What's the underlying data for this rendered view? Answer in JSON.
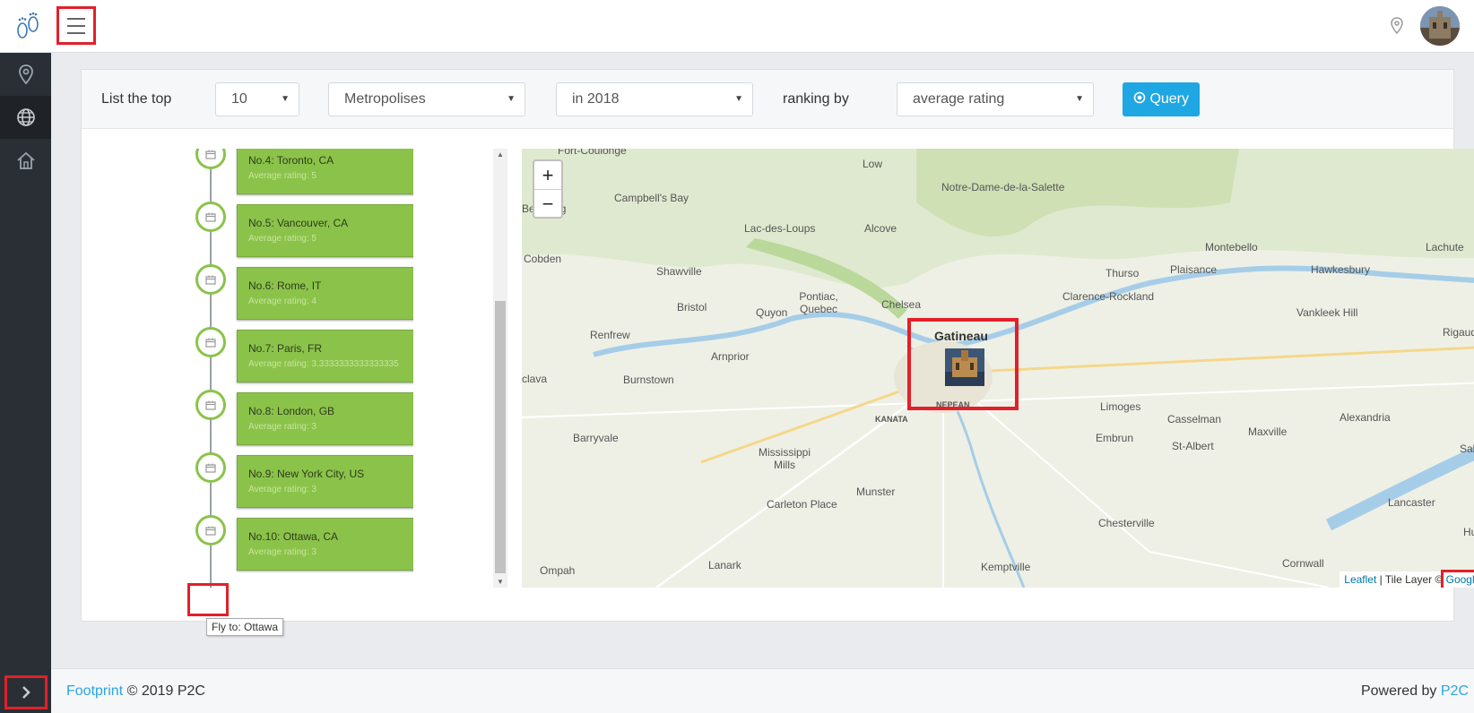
{
  "header": {
    "logo_icon": "footprint-logo-icon",
    "menu_icon": "hamburger-icon",
    "location_icon": "map-pin-icon",
    "avatar_icon": "user-avatar"
  },
  "sidebar": {
    "items": [
      {
        "icon": "map-pin-icon"
      },
      {
        "icon": "globe-icon"
      },
      {
        "icon": "home-icon"
      }
    ],
    "toggle_icon": "chevron-right-icon"
  },
  "toolbar": {
    "list_label": "List the top",
    "count": "10",
    "category": "Metropolises",
    "year": "in 2018",
    "ranking_label": "ranking by",
    "ranking": "average rating",
    "query_label": "Query"
  },
  "timeline": {
    "items": [
      {
        "title": "No.4: Toronto, CA",
        "sub": "Average rating: 5"
      },
      {
        "title": "No.5: Vancouver, CA",
        "sub": "Average rating: 5"
      },
      {
        "title": "No.6: Rome, IT",
        "sub": "Average rating: 4"
      },
      {
        "title": "No.7: Paris, FR",
        "sub": "Average rating: 3.3333333333333335"
      },
      {
        "title": "No.8: London, GB",
        "sub": "Average rating: 3"
      },
      {
        "title": "No.9: New York City, US",
        "sub": "Average rating: 3"
      },
      {
        "title": "No.10: Ottawa, CA",
        "sub": "Average rating: 3"
      }
    ],
    "tooltip": "Fly to: Ottawa"
  },
  "map": {
    "zoom_in": "+",
    "zoom_out": "−",
    "attribution_link": "Leaflet",
    "attribution_text": " | Tile Layer © ",
    "attribution_maps": "Google Maps",
    "labels": {
      "fort_coulonge": "Fort-Coulonge",
      "low": "Low",
      "notre_dame": "Notre-Dame-de-la-Salette",
      "campbells_bay": "Campbell's Bay",
      "lac_des_loups": "Lac-des-Loups",
      "alcove": "Alcove",
      "bergsborg": "Bergburg",
      "cobden": "Cobden",
      "shawville": "Shawville",
      "montebello": "Montebello",
      "lachute": "Lachute",
      "thurso": "Thurso",
      "plaisance": "Plaisance",
      "hawkesbury": "Hawkesbury",
      "bristol": "Bristol",
      "pontiac": "Pontiac, Quebec",
      "quyon": "Quyon",
      "chelsea": "Chelsea",
      "clarence_rockland": "Clarence-Rockland",
      "vankleek": "Vankleek Hill",
      "renfrew": "Renfrew",
      "gatineau": "Gatineau",
      "rigaud": "Rigaud",
      "arnprior": "Arnprior",
      "clava": "clava",
      "burnstown": "Burnstown",
      "limoges": "Limoges",
      "casselman": "Casselman",
      "alexandria": "Alexandria",
      "kanata": "KANATA",
      "nepean": "NEPEAN",
      "barryvale": "Barryvale",
      "embrun": "Embrun",
      "maxville": "Maxville",
      "st_albert": "St-Albert",
      "mississippi": "Mississippi Mills",
      "salaberry": "Salaberry-de",
      "munster": "Munster",
      "carleton": "Carleton Place",
      "lancaster": "Lancaster",
      "chesterville": "Chesterville",
      "hunting": "Hunting",
      "ompah": "Ompah",
      "lanark": "Lanark",
      "kemptville": "Kemptville",
      "cornwall": "Cornwall"
    }
  },
  "footer": {
    "brand": "Footprint",
    "copyright": " © 2019 P2C",
    "powered": "Powered by ",
    "powered_link": "P2C"
  }
}
